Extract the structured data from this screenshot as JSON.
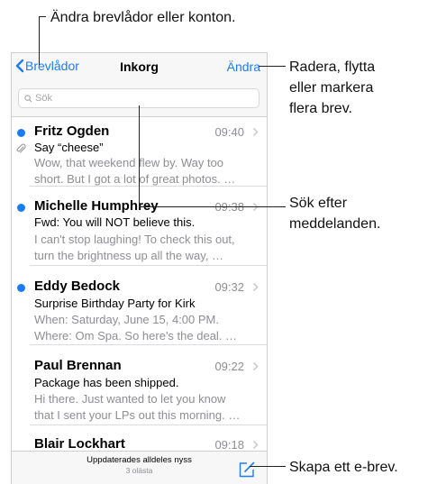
{
  "callouts": {
    "mailboxes": "Ändra brevlådor eller konton.",
    "edit_1": "Radera, flytta",
    "edit_2": "eller markera",
    "edit_3": "flera brev.",
    "search_1": "Sök efter",
    "search_2": "meddelanden.",
    "compose": "Skapa ett e-brev."
  },
  "navbar": {
    "back_label": "Brevlådor",
    "title": "Inkorg",
    "edit_label": "Ändra"
  },
  "search": {
    "placeholder": "Sök"
  },
  "messages": [
    {
      "sender": "Fritz Ogden",
      "time": "09:40",
      "subject": "Say “cheese”",
      "preview_1": "Wow, that weekend flew by. Way too",
      "preview_2": "short. But I got a lot of great photos. …",
      "unread": true,
      "attachment": true
    },
    {
      "sender": "Michelle Humphrey",
      "time": "09:38",
      "subject": "Fwd: You will NOT believe this.",
      "preview_1": "I can't stop laughing! To check this out,",
      "preview_2": "turn the brightness up all the way, …",
      "unread": true,
      "attachment": false
    },
    {
      "sender": "Eddy Bedock",
      "time": "09:32",
      "subject": "Surprise Birthday Party for Kirk",
      "preview_1": "When: Saturday, June 15, 4:00 PM.",
      "preview_2": "Where: Om Spa. So here's the deal. …",
      "unread": true,
      "attachment": false
    },
    {
      "sender": "Paul Brennan",
      "time": "09:22",
      "subject": "Package has been shipped.",
      "preview_1": "Hi there. Just wanted to let you know",
      "preview_2": "that I sent your LPs out this morning. …",
      "unread": false,
      "attachment": false
    },
    {
      "sender": "Blair Lockhart",
      "time": "09:18",
      "unread": false,
      "attachment": false
    }
  ],
  "toolbar": {
    "updated": "Uppdaterades alldeles nyss",
    "unread_count": "3 olästa"
  },
  "colors": {
    "accent": "#1c7cf4",
    "unread_dot": "#1a7cf5",
    "secondary_text": "#8e8e93"
  },
  "icons": [
    "chevron-left-icon",
    "search-icon",
    "paperclip-icon",
    "chevron-right-icon",
    "compose-icon"
  ]
}
